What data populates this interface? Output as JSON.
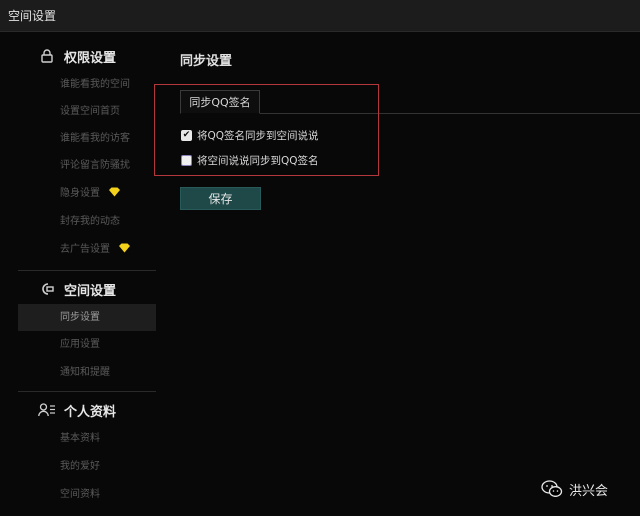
{
  "window": {
    "title": "空间设置"
  },
  "sidebar": {
    "sections": [
      {
        "title": "权限设置",
        "icon": "lock-icon",
        "items": [
          {
            "label": "谁能看我的空间",
            "badge": false
          },
          {
            "label": "设置空间首页",
            "badge": false
          },
          {
            "label": "谁能看我的访客",
            "badge": false
          },
          {
            "label": "评论留言防骚扰",
            "badge": false
          },
          {
            "label": "隐身设置",
            "badge": true
          },
          {
            "label": "封存我的动态",
            "badge": false
          },
          {
            "label": "去广告设置",
            "badge": true
          }
        ]
      },
      {
        "title": "空间设置",
        "icon": "space-settings-icon",
        "items": [
          {
            "label": "同步设置",
            "active": true
          },
          {
            "label": "应用设置"
          },
          {
            "label": "通知和提醒"
          }
        ]
      },
      {
        "title": "个人资料",
        "icon": "profile-icon",
        "items": [
          {
            "label": "基本资料"
          },
          {
            "label": "我的爱好"
          },
          {
            "label": "空间资料"
          }
        ]
      }
    ],
    "badge_color": "#f4d11a"
  },
  "main": {
    "title": "同步设置",
    "tabs": [
      {
        "label": "同步QQ签名",
        "active": true
      }
    ],
    "options": [
      {
        "label": "将QQ签名同步到空间说说",
        "checked": true
      },
      {
        "label": "将空间说说同步到QQ签名",
        "checked": false
      }
    ],
    "save_label": "保存",
    "highlight_color": "#b4373c",
    "button_color": "#1f4848"
  },
  "watermark": {
    "text": "洪兴会",
    "icon": "wechat-icon"
  }
}
